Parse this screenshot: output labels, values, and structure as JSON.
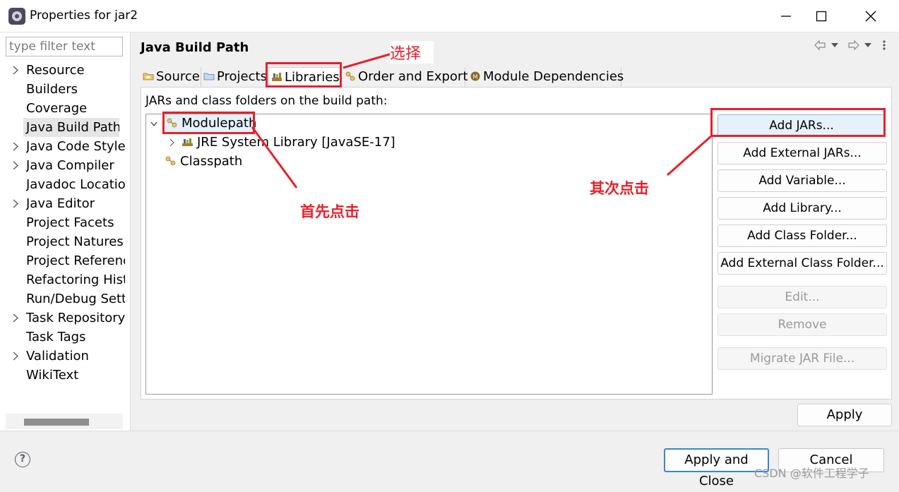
{
  "window": {
    "title": "Properties for jar2"
  },
  "sidebar": {
    "filter_placeholder": "type filter text",
    "items": [
      {
        "label": "Resource",
        "expandable": true
      },
      {
        "label": "Builders",
        "expandable": false
      },
      {
        "label": "Coverage",
        "expandable": false
      },
      {
        "label": "Java Build Path",
        "expandable": false,
        "selected": true
      },
      {
        "label": "Java Code Style",
        "expandable": true
      },
      {
        "label": "Java Compiler",
        "expandable": true
      },
      {
        "label": "Javadoc Location",
        "expandable": false
      },
      {
        "label": "Java Editor",
        "expandable": true
      },
      {
        "label": "Project Facets",
        "expandable": false
      },
      {
        "label": "Project Natures",
        "expandable": false
      },
      {
        "label": "Project References",
        "expandable": false
      },
      {
        "label": "Refactoring History",
        "expandable": false
      },
      {
        "label": "Run/Debug Settings",
        "expandable": false
      },
      {
        "label": "Task Repository",
        "expandable": true
      },
      {
        "label": "Task Tags",
        "expandable": false
      },
      {
        "label": "Validation",
        "expandable": true
      },
      {
        "label": "WikiText",
        "expandable": false
      }
    ]
  },
  "main": {
    "title": "Java Build Path",
    "tabs": [
      {
        "label": "Source",
        "icon": "source-folder-icon"
      },
      {
        "label": "Projects",
        "icon": "projects-icon"
      },
      {
        "label": "Libraries",
        "icon": "libraries-icon",
        "active": true
      },
      {
        "label": "Order and Export",
        "icon": "order-export-icon"
      },
      {
        "label": "Module Dependencies",
        "icon": "module-icon"
      }
    ],
    "panel_label": "JARs and class folders on the build path:",
    "tree": {
      "modulepath": "Modulepath",
      "jre": "JRE System Library [JavaSE-17]",
      "classpath": "Classpath"
    },
    "buttons": {
      "add_jars": "Add JARs...",
      "add_external_jars": "Add External JARs...",
      "add_variable": "Add Variable...",
      "add_library": "Add Library...",
      "add_class_folder": "Add Class Folder...",
      "add_external_class_folder": "Add External Class Folder...",
      "edit": "Edit...",
      "remove": "Remove",
      "migrate": "Migrate JAR File..."
    },
    "apply": "Apply"
  },
  "footer": {
    "apply_and_close": "Apply and Close",
    "cancel": "Cancel"
  },
  "annotations": {
    "select": "选择",
    "first_click": "首先点击",
    "second_click": "其次点击",
    "color": "#e8202a"
  },
  "watermark": "CSDN @软件工程学子"
}
